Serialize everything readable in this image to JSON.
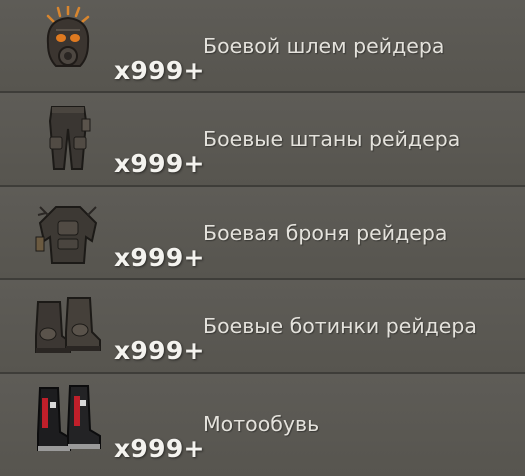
{
  "items": [
    {
      "name": "Боевой шлем рейдера",
      "quantity": "x999+",
      "icon": "raider-helmet-icon"
    },
    {
      "name": "Боевые штаны рейдера",
      "quantity": "x999+",
      "icon": "raider-pants-icon"
    },
    {
      "name": "Боевая броня рейдера",
      "quantity": "x999+",
      "icon": "raider-armor-icon"
    },
    {
      "name": "Боевые ботинки рейдера",
      "quantity": "x999+",
      "icon": "raider-boots-icon"
    },
    {
      "name": "Мотообувь",
      "quantity": "x999+",
      "icon": "moto-boots-icon"
    }
  ]
}
